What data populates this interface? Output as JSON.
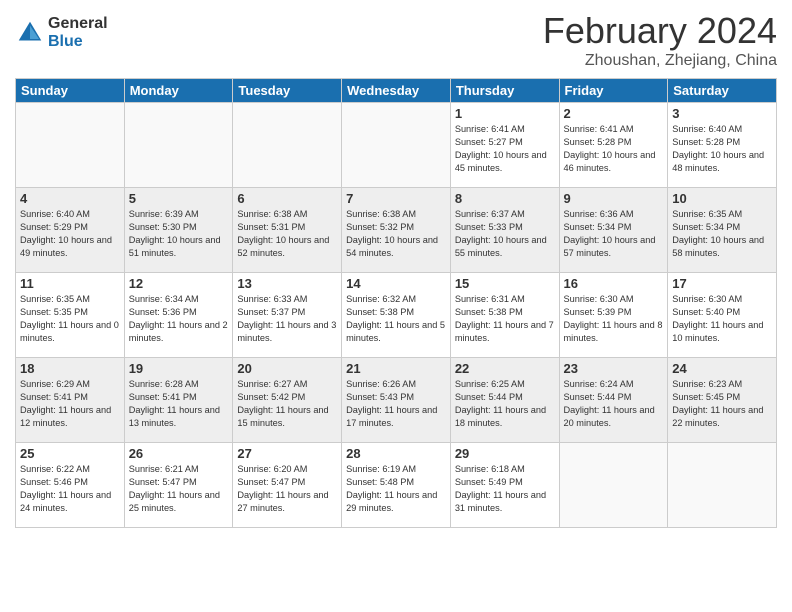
{
  "header": {
    "logo": {
      "general": "General",
      "blue": "Blue"
    },
    "title": "February 2024",
    "location": "Zhoushan, Zhejiang, China"
  },
  "days_of_week": [
    "Sunday",
    "Monday",
    "Tuesday",
    "Wednesday",
    "Thursday",
    "Friday",
    "Saturday"
  ],
  "weeks": [
    [
      {
        "day": "",
        "info": ""
      },
      {
        "day": "",
        "info": ""
      },
      {
        "day": "",
        "info": ""
      },
      {
        "day": "",
        "info": ""
      },
      {
        "day": "1",
        "info": "Sunrise: 6:41 AM\nSunset: 5:27 PM\nDaylight: 10 hours\nand 45 minutes."
      },
      {
        "day": "2",
        "info": "Sunrise: 6:41 AM\nSunset: 5:28 PM\nDaylight: 10 hours\nand 46 minutes."
      },
      {
        "day": "3",
        "info": "Sunrise: 6:40 AM\nSunset: 5:28 PM\nDaylight: 10 hours\nand 48 minutes."
      }
    ],
    [
      {
        "day": "4",
        "info": "Sunrise: 6:40 AM\nSunset: 5:29 PM\nDaylight: 10 hours\nand 49 minutes."
      },
      {
        "day": "5",
        "info": "Sunrise: 6:39 AM\nSunset: 5:30 PM\nDaylight: 10 hours\nand 51 minutes."
      },
      {
        "day": "6",
        "info": "Sunrise: 6:38 AM\nSunset: 5:31 PM\nDaylight: 10 hours\nand 52 minutes."
      },
      {
        "day": "7",
        "info": "Sunrise: 6:38 AM\nSunset: 5:32 PM\nDaylight: 10 hours\nand 54 minutes."
      },
      {
        "day": "8",
        "info": "Sunrise: 6:37 AM\nSunset: 5:33 PM\nDaylight: 10 hours\nand 55 minutes."
      },
      {
        "day": "9",
        "info": "Sunrise: 6:36 AM\nSunset: 5:34 PM\nDaylight: 10 hours\nand 57 minutes."
      },
      {
        "day": "10",
        "info": "Sunrise: 6:35 AM\nSunset: 5:34 PM\nDaylight: 10 hours\nand 58 minutes."
      }
    ],
    [
      {
        "day": "11",
        "info": "Sunrise: 6:35 AM\nSunset: 5:35 PM\nDaylight: 11 hours\nand 0 minutes."
      },
      {
        "day": "12",
        "info": "Sunrise: 6:34 AM\nSunset: 5:36 PM\nDaylight: 11 hours\nand 2 minutes."
      },
      {
        "day": "13",
        "info": "Sunrise: 6:33 AM\nSunset: 5:37 PM\nDaylight: 11 hours\nand 3 minutes."
      },
      {
        "day": "14",
        "info": "Sunrise: 6:32 AM\nSunset: 5:38 PM\nDaylight: 11 hours\nand 5 minutes."
      },
      {
        "day": "15",
        "info": "Sunrise: 6:31 AM\nSunset: 5:38 PM\nDaylight: 11 hours\nand 7 minutes."
      },
      {
        "day": "16",
        "info": "Sunrise: 6:30 AM\nSunset: 5:39 PM\nDaylight: 11 hours\nand 8 minutes."
      },
      {
        "day": "17",
        "info": "Sunrise: 6:30 AM\nSunset: 5:40 PM\nDaylight: 11 hours\nand 10 minutes."
      }
    ],
    [
      {
        "day": "18",
        "info": "Sunrise: 6:29 AM\nSunset: 5:41 PM\nDaylight: 11 hours\nand 12 minutes."
      },
      {
        "day": "19",
        "info": "Sunrise: 6:28 AM\nSunset: 5:41 PM\nDaylight: 11 hours\nand 13 minutes."
      },
      {
        "day": "20",
        "info": "Sunrise: 6:27 AM\nSunset: 5:42 PM\nDaylight: 11 hours\nand 15 minutes."
      },
      {
        "day": "21",
        "info": "Sunrise: 6:26 AM\nSunset: 5:43 PM\nDaylight: 11 hours\nand 17 minutes."
      },
      {
        "day": "22",
        "info": "Sunrise: 6:25 AM\nSunset: 5:44 PM\nDaylight: 11 hours\nand 18 minutes."
      },
      {
        "day": "23",
        "info": "Sunrise: 6:24 AM\nSunset: 5:44 PM\nDaylight: 11 hours\nand 20 minutes."
      },
      {
        "day": "24",
        "info": "Sunrise: 6:23 AM\nSunset: 5:45 PM\nDaylight: 11 hours\nand 22 minutes."
      }
    ],
    [
      {
        "day": "25",
        "info": "Sunrise: 6:22 AM\nSunset: 5:46 PM\nDaylight: 11 hours\nand 24 minutes."
      },
      {
        "day": "26",
        "info": "Sunrise: 6:21 AM\nSunset: 5:47 PM\nDaylight: 11 hours\nand 25 minutes."
      },
      {
        "day": "27",
        "info": "Sunrise: 6:20 AM\nSunset: 5:47 PM\nDaylight: 11 hours\nand 27 minutes."
      },
      {
        "day": "28",
        "info": "Sunrise: 6:19 AM\nSunset: 5:48 PM\nDaylight: 11 hours\nand 29 minutes."
      },
      {
        "day": "29",
        "info": "Sunrise: 6:18 AM\nSunset: 5:49 PM\nDaylight: 11 hours\nand 31 minutes."
      },
      {
        "day": "",
        "info": ""
      },
      {
        "day": "",
        "info": ""
      }
    ]
  ]
}
